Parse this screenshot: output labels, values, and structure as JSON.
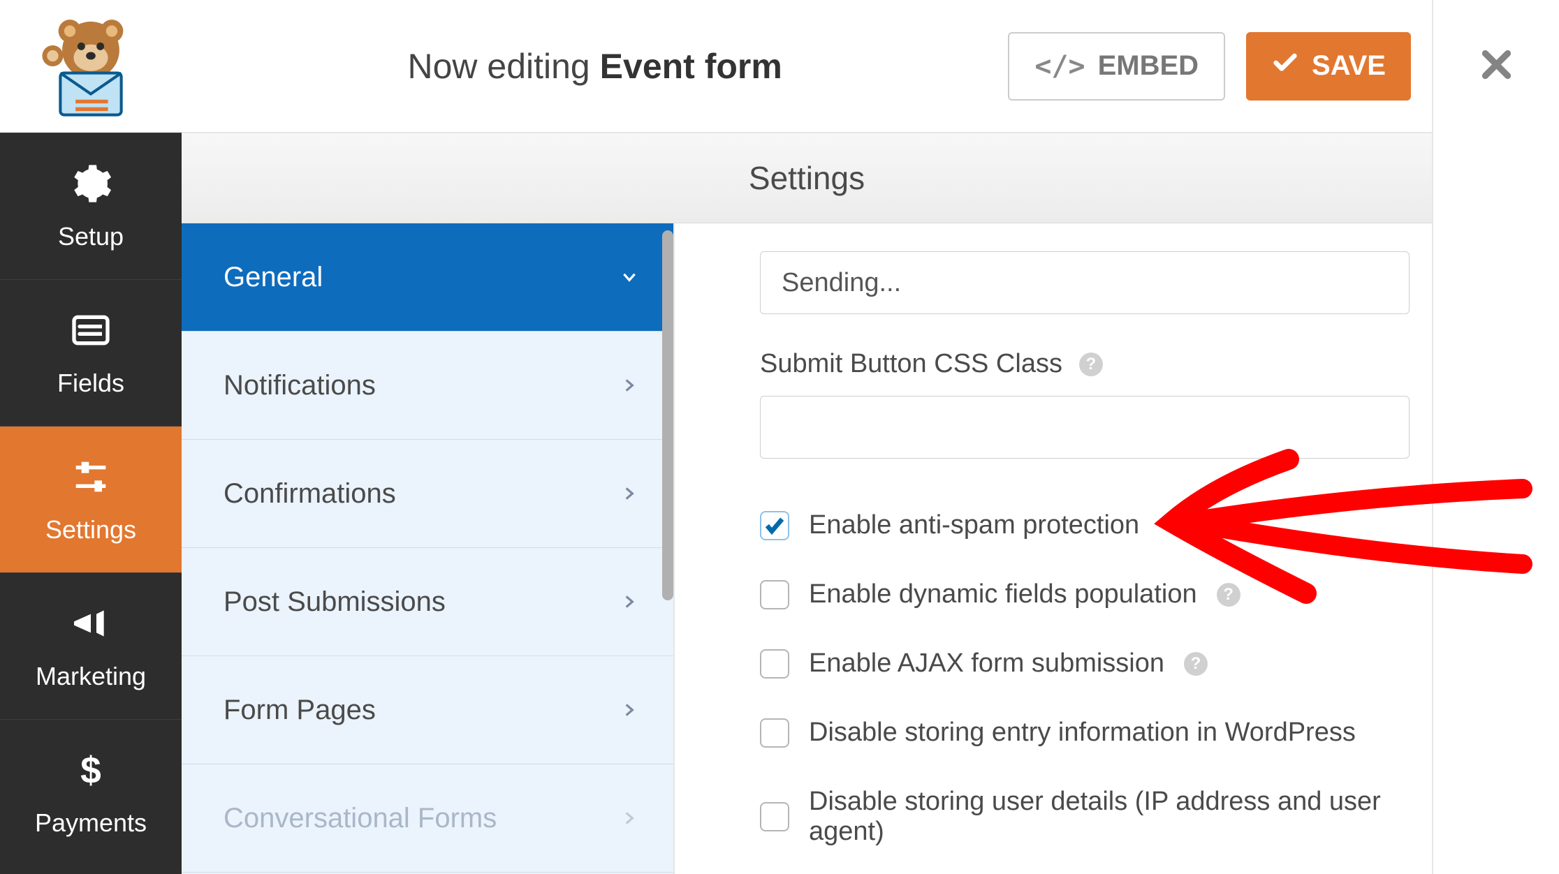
{
  "header": {
    "now_editing_prefix": "Now editing",
    "form_name": "Event form",
    "embed_label": "EMBED",
    "save_label": "SAVE"
  },
  "sidebar": {
    "items": [
      {
        "id": "setup",
        "label": "Setup"
      },
      {
        "id": "fields",
        "label": "Fields"
      },
      {
        "id": "settings",
        "label": "Settings"
      },
      {
        "id": "marketing",
        "label": "Marketing"
      },
      {
        "id": "payments",
        "label": "Payments"
      }
    ],
    "active_id": "settings"
  },
  "panel_title": "Settings",
  "settings_menu": {
    "items": [
      {
        "id": "general",
        "label": "General",
        "active": true
      },
      {
        "id": "notifications",
        "label": "Notifications"
      },
      {
        "id": "confirmations",
        "label": "Confirmations"
      },
      {
        "id": "post_submissions",
        "label": "Post Submissions"
      },
      {
        "id": "form_pages",
        "label": "Form Pages"
      },
      {
        "id": "conversational_forms",
        "label": "Conversational Forms",
        "disabled": true
      }
    ]
  },
  "form_settings": {
    "sending_input_value": "Sending...",
    "css_class_label": "Submit Button CSS Class",
    "css_class_value": "",
    "checkboxes": [
      {
        "id": "antispam",
        "label": "Enable anti-spam protection",
        "checked": true,
        "help": false
      },
      {
        "id": "dynamic_fields",
        "label": "Enable dynamic fields population",
        "checked": false,
        "help": true
      },
      {
        "id": "ajax_submit",
        "label": "Enable AJAX form submission",
        "checked": false,
        "help": true
      },
      {
        "id": "disable_entry",
        "label": "Disable storing entry information in WordPress",
        "checked": false,
        "help": false
      },
      {
        "id": "disable_user",
        "label": "Disable storing user details (IP address and user agent)",
        "checked": false,
        "help": false
      }
    ]
  },
  "colors": {
    "brand_orange": "#e27730",
    "brand_blue": "#0e6cbd"
  }
}
